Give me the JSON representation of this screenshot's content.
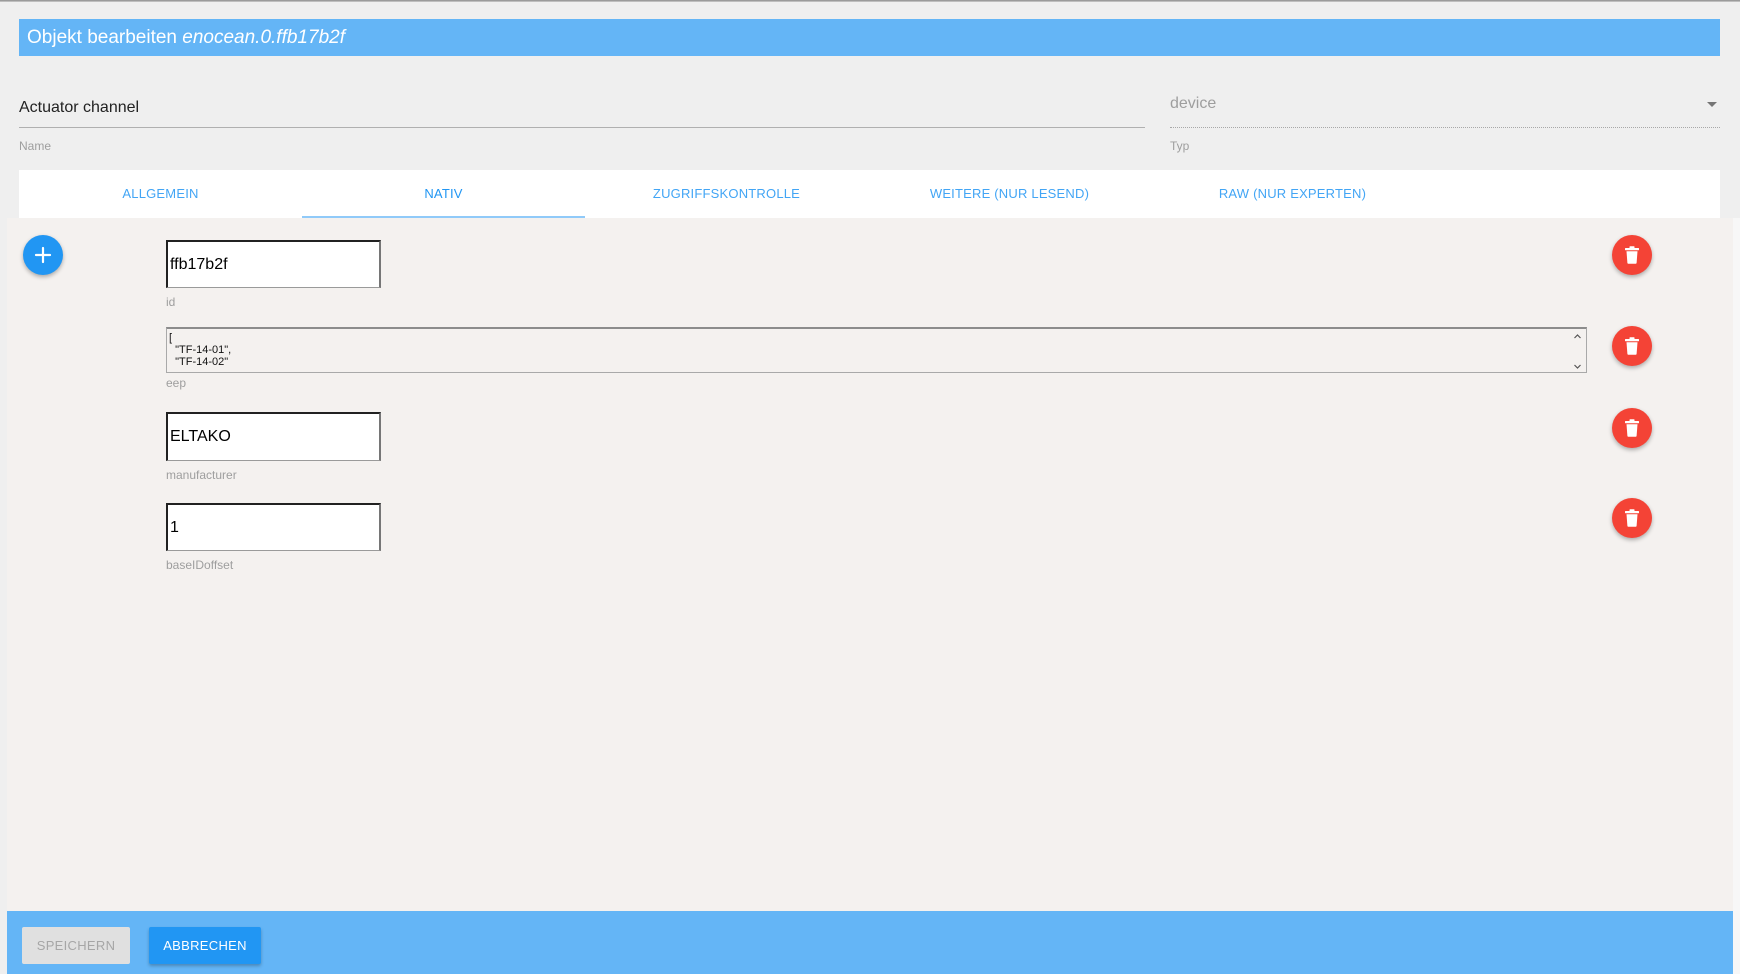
{
  "dialog": {
    "title_prefix": "Objekt bearbeiten",
    "title_object_id": "enocean.0.ffb17b2f"
  },
  "fields": {
    "name": {
      "value": "Actuator channel",
      "label": "Name"
    },
    "type": {
      "value": "device",
      "label": "Typ"
    }
  },
  "tabs": [
    {
      "label": "ALLGEMEIN",
      "active": false
    },
    {
      "label": "NATIV",
      "active": true
    },
    {
      "label": "ZUGRIFFSKONTROLLE",
      "active": false
    },
    {
      "label": "WEITERE (NUR LESEND)",
      "active": false
    },
    {
      "label": "RAW (NUR EXPERTEN)",
      "active": false
    }
  ],
  "native": {
    "rows": [
      {
        "key": "id",
        "value": "ffb17b2f"
      },
      {
        "key": "eep",
        "value": "[\n  \"TF-14-01\",\n  \"TF-14-02\""
      },
      {
        "key": "manufacturer",
        "value": "ELTAKO"
      },
      {
        "key": "baseIDoffset",
        "value": "1"
      }
    ]
  },
  "footer": {
    "save_label": "SPEICHERN",
    "cancel_label": "ABBRECHEN"
  },
  "icons": {
    "add": "plus-icon",
    "delete": "trash-icon",
    "dropdown": "caret-down-icon"
  },
  "colors": {
    "header_bar": "#64b5f6",
    "tab_text": "#42a5f5",
    "primary": "#2196f3",
    "danger": "#f44336",
    "content_bg": "#f4f1ef"
  }
}
